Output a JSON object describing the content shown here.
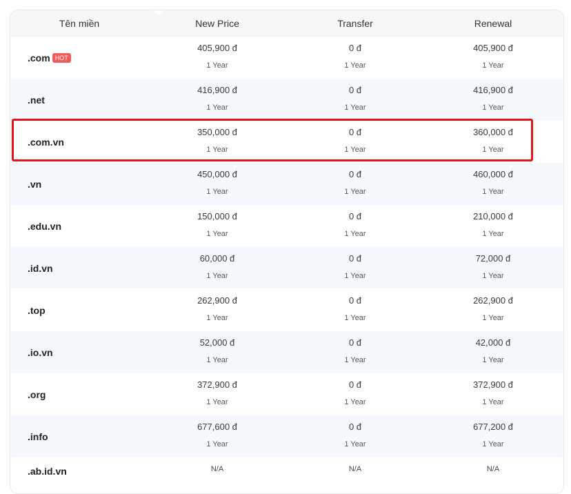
{
  "header": {
    "domain": "Tên miền",
    "new_price": "New Price",
    "transfer": "Transfer",
    "renewal": "Renewal"
  },
  "rows": [
    {
      "tld": ".com",
      "badge": "HOT",
      "new_price": "405,900 đ",
      "new_term": "1 Year",
      "transfer": "0 đ",
      "transfer_term": "1 Year",
      "renewal": "405,900 đ",
      "renewal_term": "1 Year"
    },
    {
      "tld": ".net",
      "new_price": "416,900 đ",
      "new_term": "1 Year",
      "transfer": "0 đ",
      "transfer_term": "1 Year",
      "renewal": "416,900 đ",
      "renewal_term": "1 Year"
    },
    {
      "tld": ".com.vn",
      "new_price": "350,000 đ",
      "new_term": "1 Year",
      "transfer": "0 đ",
      "transfer_term": "1 Year",
      "renewal": "360,000 đ",
      "renewal_term": "1 Year",
      "highlighted": true
    },
    {
      "tld": ".vn",
      "new_price": "450,000 đ",
      "new_term": "1 Year",
      "transfer": "0 đ",
      "transfer_term": "1 Year",
      "renewal": "460,000 đ",
      "renewal_term": "1 Year"
    },
    {
      "tld": ".edu.vn",
      "new_price": "150,000 đ",
      "new_term": "1 Year",
      "transfer": "0 đ",
      "transfer_term": "1 Year",
      "renewal": "210,000 đ",
      "renewal_term": "1 Year"
    },
    {
      "tld": ".id.vn",
      "new_price": "60,000 đ",
      "new_term": "1 Year",
      "transfer": "0 đ",
      "transfer_term": "1 Year",
      "renewal": "72,000 đ",
      "renewal_term": "1 Year"
    },
    {
      "tld": ".top",
      "new_price": "262,900 đ",
      "new_term": "1 Year",
      "transfer": "0 đ",
      "transfer_term": "1 Year",
      "renewal": "262,900 đ",
      "renewal_term": "1 Year"
    },
    {
      "tld": ".io.vn",
      "new_price": "52,000 đ",
      "new_term": "1 Year",
      "transfer": "0 đ",
      "transfer_term": "1 Year",
      "renewal": "42,000 đ",
      "renewal_term": "1 Year"
    },
    {
      "tld": ".org",
      "new_price": "372,900 đ",
      "new_term": "1 Year",
      "transfer": "0 đ",
      "transfer_term": "1 Year",
      "renewal": "372,900 đ",
      "renewal_term": "1 Year"
    },
    {
      "tld": ".info",
      "new_price": "677,600 đ",
      "new_term": "1 Year",
      "transfer": "0 đ",
      "transfer_term": "1 Year",
      "renewal": "677,200 đ",
      "renewal_term": "1 Year"
    },
    {
      "tld": ".ab.id.vn",
      "new_price": "N/A",
      "transfer": "N/A",
      "renewal": "N/A"
    }
  ],
  "colors": {
    "header_bg": "#f6f7f8",
    "alt_row_bg": "#f5f9fd",
    "hot_badge": "#ef5a5a",
    "highlight_border": "#e1141b"
  }
}
